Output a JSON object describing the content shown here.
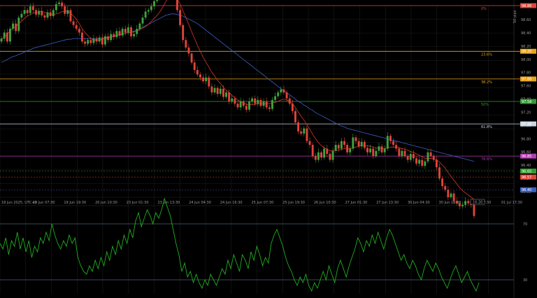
{
  "colors": {
    "background": "#000000",
    "grid": "#1f1f1f",
    "bull": "#3fa33f",
    "bear": "#e0453a",
    "ma_fast": "#d8352a",
    "ma_slow": "#3b5fc4",
    "rsi_line": "#1fae1f",
    "rsi_level": "#6f8fb5",
    "axis_text": "#9a9a9a"
  },
  "chart_data": [
    {
      "type": "candlestick",
      "ylim": [
        96.3,
        98.86
      ],
      "yticks": [
        "98.60",
        "98.40",
        "98.20",
        "98.00",
        "97.80",
        "97.60",
        "97.40",
        "97.20",
        "97.00",
        "96.80",
        "96.60",
        "96.40",
        "96.20",
        "96.00"
      ],
      "xticks": [
        "18 Jun 2025, UTC+0",
        "19 Jun 07:30",
        "19 Jun 19:30",
        "20 Jun 10:30",
        "23 Jun 01:30",
        "23 Jun 13:30",
        "24 Jun 04:30",
        "24 Jun 16:30",
        "25 Jun 07:30",
        "25 Jun 19:30",
        "26 Jun 10:30",
        "27 Jun 01:30",
        "27 Jun 13:30",
        "30 Jun 04:30",
        "30 Jun 16:30",
        "01 Jul 07:30",
        "01 Jul 17:30"
      ],
      "range_label": "50 pips",
      "time_label": "16:30",
      "fib_levels": [
        {
          "label": "0%",
          "price": 98.86,
          "color": "#e0453a",
          "tag": "98.86"
        },
        {
          "label": "23.6%",
          "price": 98.25,
          "color": "#e8a317",
          "tag": "98.25"
        },
        {
          "label": "38.2%",
          "price": 97.88,
          "color": "#e8a317",
          "tag": "97.88"
        },
        {
          "label": "50%",
          "price": 97.58,
          "color": "#2f9e2f",
          "tag": "97.58"
        },
        {
          "label": "61.8%",
          "price": 97.28,
          "color": "#c9d6e3",
          "tag": "97.28"
        },
        {
          "label": "78.6%",
          "price": 96.85,
          "color": "#b33ab3",
          "tag": "96.85"
        }
      ],
      "price_tags": [
        {
          "price": 96.65,
          "color": "#2f9e2f",
          "text": "96.65"
        },
        {
          "price": 96.57,
          "color": "#e0453a",
          "text": "96.57"
        },
        {
          "price": 96.4,
          "color": "#3b5fc4",
          "text": "96.40"
        }
      ],
      "close": [
        98.42,
        98.5,
        98.38,
        98.55,
        98.62,
        98.52,
        98.7,
        98.75,
        98.8,
        98.76,
        98.85,
        98.8,
        98.74,
        98.79,
        98.73,
        98.7,
        98.77,
        98.72,
        98.8,
        98.88,
        98.9,
        98.85,
        98.75,
        98.8,
        98.65,
        98.6,
        98.55,
        98.5,
        98.38,
        98.35,
        98.4,
        98.36,
        98.42,
        98.38,
        98.43,
        98.34,
        98.45,
        98.4,
        98.48,
        98.44,
        98.52,
        98.46,
        98.55,
        98.5,
        98.57,
        98.45,
        98.48,
        98.55,
        98.62,
        98.7,
        98.78,
        98.8,
        98.85,
        98.92,
        99.0,
        98.97,
        99.1,
        99.27,
        99.35,
        99.3,
        99.05,
        98.8,
        98.6,
        98.4,
        98.3,
        98.22,
        98.1,
        98.0,
        97.94,
        97.9,
        97.85,
        97.9,
        97.78,
        97.7,
        97.76,
        97.68,
        97.75,
        97.64,
        97.7,
        97.58,
        97.62,
        97.55,
        97.5,
        97.58,
        97.52,
        97.47,
        97.58,
        97.62,
        97.55,
        97.6,
        97.52,
        97.58,
        97.5,
        97.48,
        97.6,
        97.65,
        97.7,
        97.74,
        97.7,
        97.62,
        97.55,
        97.45,
        97.3,
        97.18,
        97.15,
        97.22,
        97.05,
        97.0,
        96.85,
        96.8,
        96.9,
        96.83,
        96.95,
        96.88,
        96.8,
        96.92,
        97.0,
        96.95,
        97.05,
        97.0,
        96.9,
        96.95,
        97.1,
        97.05,
        96.98,
        97.04,
        96.96,
        96.9,
        96.95,
        96.85,
        96.92,
        96.98,
        96.9,
        96.95,
        97.12,
        97.05,
        97.0,
        96.95,
        96.85,
        96.92,
        96.85,
        96.8,
        96.88,
        96.82,
        96.75,
        96.8,
        96.72,
        96.78,
        96.9,
        96.85,
        96.8,
        96.7,
        96.55,
        96.45,
        96.4,
        96.3,
        96.35,
        96.25,
        96.22,
        96.18,
        96.2,
        96.25,
        96.22,
        96.2,
        96.05
      ],
      "ma_fast": [
        98.4,
        98.44,
        98.48,
        98.52,
        98.56,
        98.58,
        98.62,
        98.65,
        98.69,
        98.72,
        98.74,
        98.76,
        98.77,
        98.78,
        98.78,
        98.77,
        98.76,
        98.74,
        98.74,
        98.75,
        98.76,
        98.78,
        98.78,
        98.79,
        98.76,
        98.72,
        98.68,
        98.62,
        98.55,
        98.5,
        98.46,
        98.42,
        98.4,
        98.4,
        98.4,
        98.41,
        98.42,
        98.43,
        98.44,
        98.45,
        98.46,
        98.47,
        98.48,
        98.49,
        98.5,
        98.5,
        98.51,
        98.52,
        98.54,
        98.56,
        98.58,
        98.61,
        98.65,
        98.69,
        98.73,
        98.78,
        98.84,
        98.91,
        98.98,
        99.02,
        99.0,
        98.95,
        98.88,
        98.79,
        98.7,
        98.61,
        98.51,
        98.42,
        98.33,
        98.25,
        98.17,
        98.1,
        98.04,
        97.97,
        97.92,
        97.86,
        97.82,
        97.77,
        97.73,
        97.7,
        97.66,
        97.63,
        97.6,
        97.58,
        97.56,
        97.54,
        97.54,
        97.54,
        97.54,
        97.55,
        97.55,
        97.55,
        97.55,
        97.55,
        97.56,
        97.57,
        97.58,
        97.6,
        97.61,
        97.6,
        97.58,
        97.55,
        97.5,
        97.44,
        97.38,
        97.33,
        97.27,
        97.21,
        97.14,
        97.08,
        97.03,
        96.99,
        96.96,
        96.94,
        96.92,
        96.92,
        96.93,
        96.93,
        96.94,
        96.95,
        96.95,
        96.95,
        96.96,
        96.97,
        96.98,
        96.99,
        96.99,
        96.99,
        96.98,
        96.97,
        96.96,
        96.96,
        96.95,
        96.95,
        96.96,
        96.97,
        96.97,
        96.97,
        96.96,
        96.95,
        96.94,
        96.93,
        96.91,
        96.9,
        96.88,
        96.86,
        96.84,
        96.82,
        96.82,
        96.82,
        96.81,
        96.8,
        96.77,
        96.73,
        96.69,
        96.63,
        96.58,
        96.53,
        96.48,
        96.43,
        96.39,
        96.36,
        96.33,
        96.3,
        96.27
      ],
      "ma_slow": [
        98.1,
        98.12,
        98.14,
        98.16,
        98.18,
        98.19,
        98.21,
        98.22,
        98.24,
        98.26,
        98.27,
        98.29,
        98.3,
        98.31,
        98.32,
        98.33,
        98.34,
        98.35,
        98.36,
        98.37,
        98.38,
        98.39,
        98.4,
        98.41,
        98.41,
        98.42,
        98.42,
        98.42,
        98.42,
        98.42,
        98.42,
        98.42,
        98.42,
        98.42,
        98.43,
        98.43,
        98.43,
        98.44,
        98.44,
        98.45,
        98.46,
        98.47,
        98.48,
        98.49,
        98.5,
        98.51,
        98.52,
        98.53,
        98.55,
        98.57,
        98.59,
        98.61,
        98.63,
        98.65,
        98.67,
        98.69,
        98.71,
        98.73,
        98.74,
        98.75,
        98.75,
        98.74,
        98.73,
        98.72,
        98.7,
        98.68,
        98.66,
        98.64,
        98.62,
        98.59,
        98.56,
        98.53,
        98.5,
        98.47,
        98.44,
        98.41,
        98.38,
        98.35,
        98.32,
        98.29,
        98.26,
        98.23,
        98.2,
        98.17,
        98.14,
        98.11,
        98.08,
        98.05,
        98.02,
        97.99,
        97.96,
        97.93,
        97.9,
        97.87,
        97.84,
        97.81,
        97.78,
        97.75,
        97.72,
        97.7,
        97.67,
        97.64,
        97.61,
        97.58,
        97.56,
        97.53,
        97.51,
        97.48,
        97.46,
        97.43,
        97.41,
        97.39,
        97.37,
        97.35,
        97.33,
        97.31,
        97.29,
        97.27,
        97.25,
        97.24,
        97.22,
        97.21,
        97.2,
        97.19,
        97.18,
        97.17,
        97.16,
        97.15,
        97.14,
        97.13,
        97.12,
        97.11,
        97.1,
        97.09,
        97.08,
        97.07,
        97.06,
        97.05,
        97.04,
        97.03,
        97.02,
        97.01,
        97.0,
        96.99,
        96.98,
        96.97,
        96.96,
        96.95,
        96.94,
        96.93,
        96.92,
        96.91,
        96.9,
        96.89,
        96.88,
        96.87,
        96.86,
        96.85,
        96.84,
        96.83,
        96.82,
        96.81,
        96.8,
        96.79,
        96.78
      ]
    },
    {
      "type": "line",
      "ylim": [
        20,
        80
      ],
      "yticks": [
        "70",
        "30"
      ],
      "levels": [
        70,
        30
      ],
      "values": [
        56,
        52,
        60,
        48,
        58,
        54,
        64,
        52,
        60,
        50,
        58,
        46,
        54,
        50,
        60,
        56,
        64,
        58,
        70,
        62,
        56,
        52,
        58,
        54,
        62,
        56,
        60,
        46,
        40,
        36,
        34,
        40,
        36,
        44,
        38,
        46,
        40,
        50,
        44,
        54,
        48,
        58,
        52,
        62,
        56,
        66,
        60,
        72,
        78,
        68,
        74,
        80,
        76,
        70,
        78,
        74,
        80,
        88,
        82,
        76,
        66,
        56,
        48,
        36,
        42,
        32,
        36,
        28,
        34,
        28,
        24,
        30,
        26,
        34,
        30,
        26,
        32,
        38,
        34,
        44,
        38,
        48,
        42,
        36,
        48,
        44,
        38,
        50,
        44,
        54,
        48,
        40,
        46,
        42,
        56,
        62,
        66,
        60,
        54,
        46,
        40,
        36,
        30,
        26,
        32,
        28,
        34,
        26,
        22,
        28,
        24,
        30,
        36,
        30,
        40,
        34,
        28,
        38,
        44,
        38,
        32,
        40,
        46,
        52,
        60,
        56,
        50,
        58,
        54,
        62,
        56,
        64,
        58,
        52,
        60,
        66,
        62,
        56,
        50,
        44,
        48,
        42,
        38,
        44,
        40,
        34,
        30,
        38,
        44,
        40,
        36,
        42,
        38,
        32,
        28,
        24,
        30,
        36,
        40,
        34,
        28,
        32,
        36,
        30,
        26,
        22,
        28
      ]
    }
  ]
}
